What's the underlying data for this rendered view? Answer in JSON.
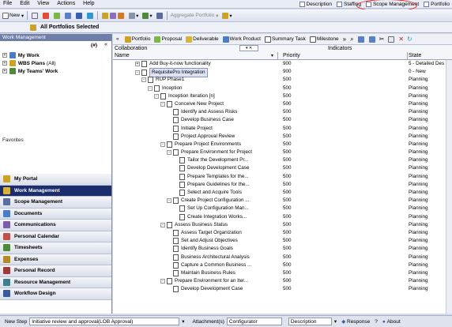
{
  "menu": [
    "File",
    "Edit",
    "View",
    "Actions",
    "Help"
  ],
  "top_tabs": [
    {
      "label": "Description",
      "icon": "description-icon"
    },
    {
      "label": "Staffing",
      "icon": "staffing-icon"
    },
    {
      "label": "Scope Management",
      "icon": "scope-management-icon"
    },
    {
      "label": "Portfolio",
      "icon": "portfolio-icon"
    }
  ],
  "toolbar": {
    "new_label": "New",
    "aggregate_label": "Aggregate Portfolio"
  },
  "titlebar": {
    "title": "All Portfolios Selected"
  },
  "left_panel": {
    "header": "Work Management",
    "items": [
      {
        "label": "My Work",
        "suffix": ""
      },
      {
        "label": "WBS Plans",
        "suffix": "(All)"
      },
      {
        "label": "My Teams' Work",
        "suffix": ""
      }
    ],
    "counter": "(#)",
    "favorites": "Favorites"
  },
  "nav": [
    {
      "label": "My Portal",
      "color": "#c9a227"
    },
    {
      "label": "Work Management",
      "color": "#d8b23a"
    },
    {
      "label": "Scope Management",
      "color": "#5a6e9c"
    },
    {
      "label": "Documents",
      "color": "#4b7cc6"
    },
    {
      "label": "Communications",
      "color": "#7a5fa8"
    },
    {
      "label": "Personal Calendar",
      "color": "#c0504d"
    },
    {
      "label": "Timesheets",
      "color": "#4f8a3a"
    },
    {
      "label": "Expenses",
      "color": "#b58a2a"
    },
    {
      "label": "Personal Record",
      "color": "#a03a3a"
    },
    {
      "label": "Resource Management",
      "color": "#3f7e8c"
    },
    {
      "label": "Workflow Design",
      "color": "#3a5a9c"
    }
  ],
  "main_toolbar": [
    "Portfolio",
    "Proposal",
    "Deliverable",
    "Work Product",
    "Summary Task",
    "Milestone"
  ],
  "grid": {
    "collaboration_label": "Collaboration",
    "indicators_label": "Indicators",
    "name_label": "Name",
    "priority_label": "Priority",
    "state_label": "State",
    "rows": [
      {
        "name": "Add Buy-it-now functionality",
        "priority": "900",
        "state": "5 - Detailed Des",
        "indent": 0,
        "exp": "+",
        "selected": false
      },
      {
        "name": "RequisitePro Integration",
        "priority": "900",
        "state": "0 - New",
        "indent": 0,
        "exp": "-",
        "selected": true
      },
      {
        "name": "RUP Phase1",
        "priority": "500",
        "state": "Planning",
        "indent": 1,
        "exp": "-",
        "selected": false
      },
      {
        "name": "Inception",
        "priority": "500",
        "state": "Planning",
        "indent": 2,
        "exp": "-",
        "selected": false
      },
      {
        "name": "Inception Iteration [n]",
        "priority": "500",
        "state": "Planning",
        "indent": 3,
        "exp": "-",
        "selected": false
      },
      {
        "name": "Conceive New Project",
        "priority": "500",
        "state": "Planning",
        "indent": 4,
        "exp": "-",
        "selected": false
      },
      {
        "name": "Identify and Assess Risks",
        "priority": "500",
        "state": "Planning",
        "indent": 5,
        "exp": "",
        "selected": false
      },
      {
        "name": "Develop Business Case",
        "priority": "500",
        "state": "Planning",
        "indent": 5,
        "exp": "",
        "selected": false
      },
      {
        "name": "Initiate Project",
        "priority": "500",
        "state": "Planning",
        "indent": 5,
        "exp": "",
        "selected": false
      },
      {
        "name": "Project Approval Review",
        "priority": "500",
        "state": "Planning",
        "indent": 5,
        "exp": "",
        "selected": false
      },
      {
        "name": "Prepare Project Environments",
        "priority": "500",
        "state": "Planning",
        "indent": 4,
        "exp": "-",
        "selected": false
      },
      {
        "name": "Prepare Environment for Project",
        "priority": "500",
        "state": "Planning",
        "indent": 5,
        "exp": "-",
        "selected": false
      },
      {
        "name": "Tailor the Development Pr...",
        "priority": "500",
        "state": "Planning",
        "indent": 6,
        "exp": "",
        "selected": false
      },
      {
        "name": "Develop Development Case",
        "priority": "500",
        "state": "Planning",
        "indent": 6,
        "exp": "",
        "selected": false
      },
      {
        "name": "Prepare Templates for the...",
        "priority": "500",
        "state": "Planning",
        "indent": 6,
        "exp": "",
        "selected": false
      },
      {
        "name": "Prepare Guidelines for the...",
        "priority": "500",
        "state": "Planning",
        "indent": 6,
        "exp": "",
        "selected": false
      },
      {
        "name": "Select and Acquire Tools",
        "priority": "500",
        "state": "Planning",
        "indent": 6,
        "exp": "",
        "selected": false
      },
      {
        "name": "Create Project Configuration ...",
        "priority": "500",
        "state": "Planning",
        "indent": 5,
        "exp": "-",
        "selected": false
      },
      {
        "name": "Set Up Configuration Man...",
        "priority": "500",
        "state": "Planning",
        "indent": 6,
        "exp": "",
        "selected": false
      },
      {
        "name": "Create Integration Works...",
        "priority": "500",
        "state": "Planning",
        "indent": 6,
        "exp": "",
        "selected": false
      },
      {
        "name": "Assess Business Status",
        "priority": "500",
        "state": "Planning",
        "indent": 4,
        "exp": "-",
        "selected": false
      },
      {
        "name": "Assess Target Organization",
        "priority": "500",
        "state": "Planning",
        "indent": 5,
        "exp": "",
        "selected": false
      },
      {
        "name": "Set and Adjust Objectives",
        "priority": "500",
        "state": "Planning",
        "indent": 5,
        "exp": "",
        "selected": false
      },
      {
        "name": "Identify Business Goals",
        "priority": "500",
        "state": "Planning",
        "indent": 5,
        "exp": "",
        "selected": false
      },
      {
        "name": "Business Architectural Analysis",
        "priority": "500",
        "state": "Planning",
        "indent": 5,
        "exp": "",
        "selected": false
      },
      {
        "name": "Capture a Common Business ...",
        "priority": "500",
        "state": "Planning",
        "indent": 5,
        "exp": "",
        "selected": false
      },
      {
        "name": "Maintain Business Rules",
        "priority": "500",
        "state": "Planning",
        "indent": 5,
        "exp": "",
        "selected": false
      },
      {
        "name": "Prepare Environment for an Iter...",
        "priority": "500",
        "state": "Planning",
        "indent": 4,
        "exp": "-",
        "selected": false
      },
      {
        "name": "Develop Development Case",
        "priority": "500",
        "state": "Planning",
        "indent": 5,
        "exp": "",
        "selected": false
      }
    ]
  },
  "status_bar": {
    "new_step": "New Step",
    "step_value": "Initiative review and approval(LOB Approval)",
    "attachments": "Attachment(s)",
    "configurator": "Configurator",
    "description": "Description",
    "response": "Response",
    "about": "About"
  }
}
